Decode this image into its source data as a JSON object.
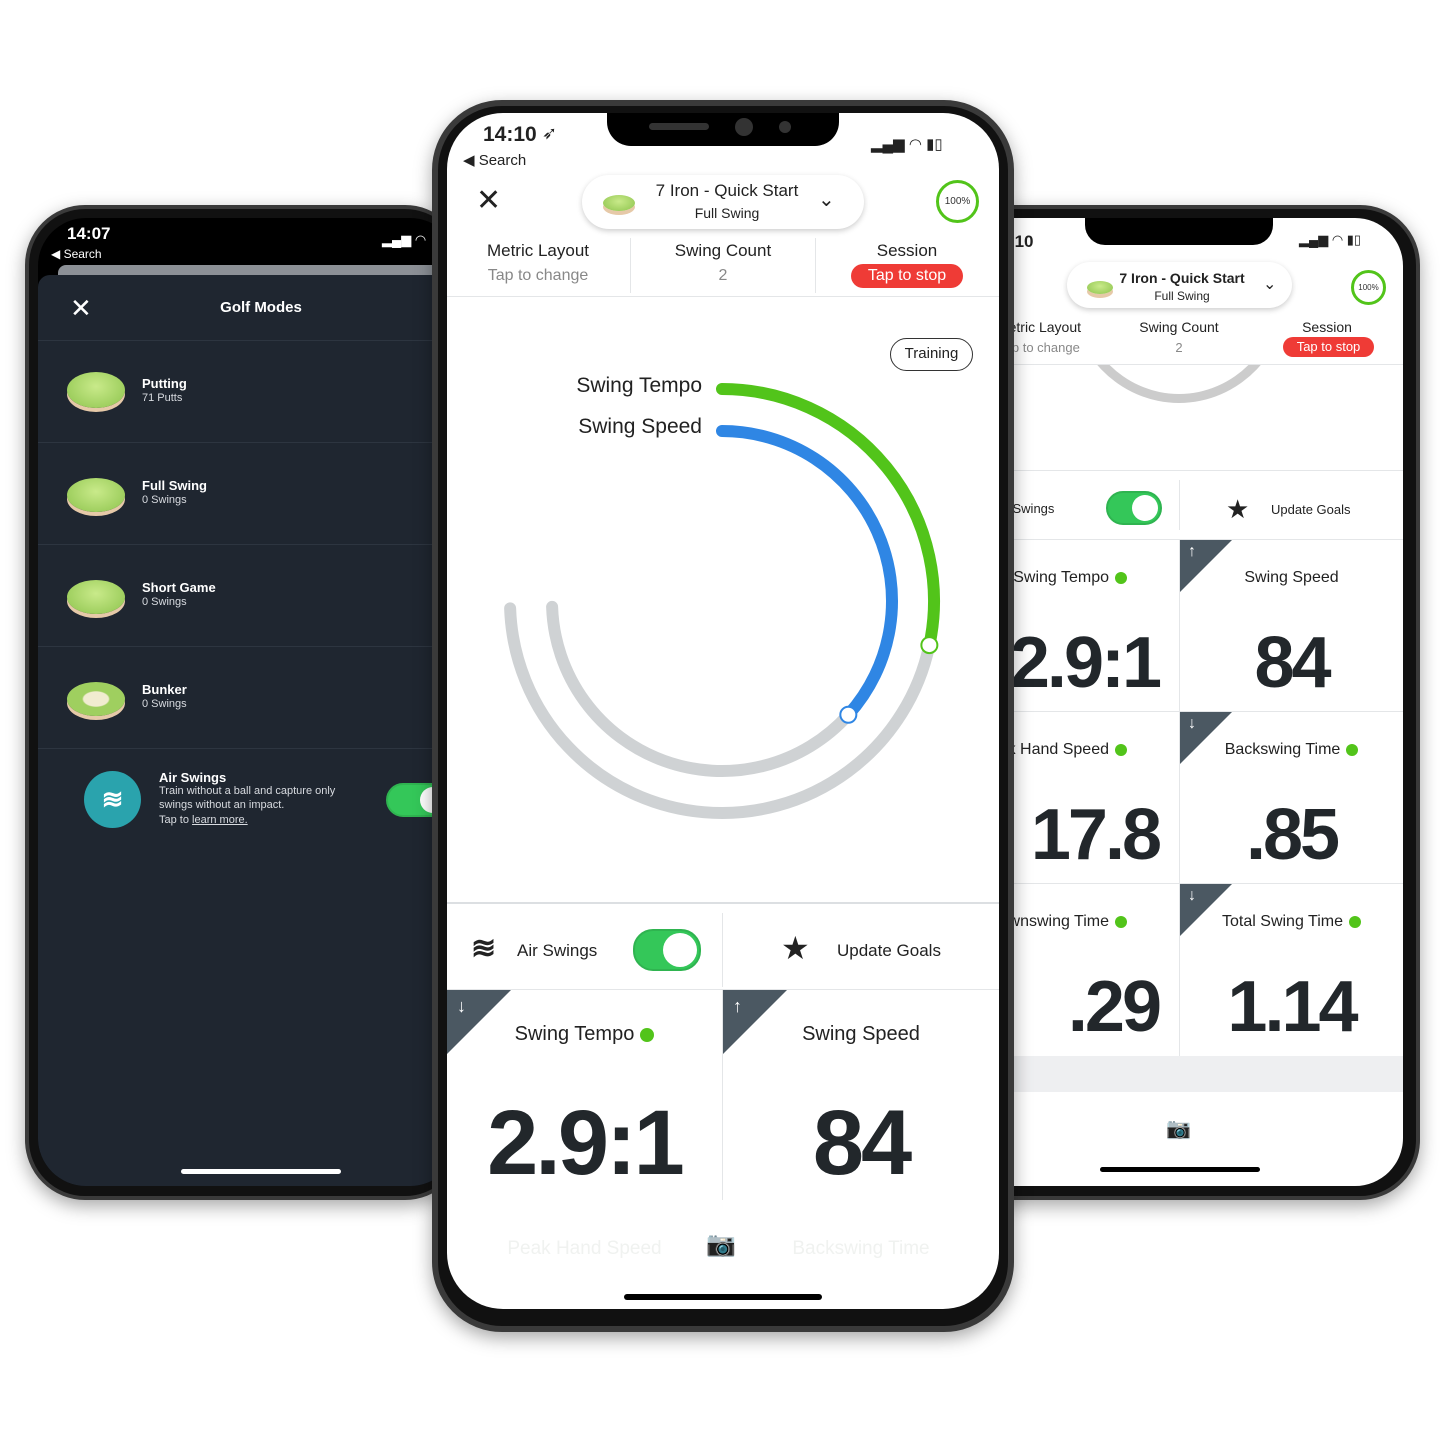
{
  "left_phone": {
    "status": {
      "time": "14:07",
      "back": "◀ Search"
    },
    "title": "Golf Modes",
    "modes": [
      {
        "name": "Putting",
        "count": "71 Putts"
      },
      {
        "name": "Full Swing",
        "count": "0 Swings"
      },
      {
        "name": "Short Game",
        "count": "0 Swings"
      },
      {
        "name": "Bunker",
        "count": "0 Swings"
      }
    ],
    "air_swings": {
      "title": "Air Swings",
      "desc1": "Train without a ball and capture only",
      "desc2": "swings without an impact.",
      "tap": "Tap to ",
      "link": "learn more.",
      "enabled": true
    }
  },
  "center_phone": {
    "status": {
      "time": "14:10",
      "back": "◀ Search"
    },
    "club": {
      "title": "7 Iron - Quick Start",
      "mode": "Full Swing"
    },
    "battery": "100%",
    "stats": [
      {
        "label": "Metric Layout",
        "value": "Tap to change"
      },
      {
        "label": "Swing Count",
        "value": "2"
      },
      {
        "label": "Session",
        "value": "Tap to stop"
      }
    ],
    "training": "Training",
    "gauge": {
      "outer_label": "Swing Tempo",
      "inner_label": "Swing Speed",
      "colors": {
        "tempo": "#52c41a",
        "speed": "#2f86e4",
        "track": "#cfd2d4"
      }
    },
    "air_swings_label": "Air Swings",
    "air_swings_on": true,
    "update_goals": "Update Goals",
    "metrics": [
      {
        "label": "Swing Tempo",
        "value": "2.9:1",
        "trend": "down",
        "dot": true
      },
      {
        "label": "Swing Speed",
        "value": "84",
        "trend": "up",
        "dot": false
      }
    ],
    "faded_metrics": [
      "Peak Hand Speed",
      "Backswing Time"
    ]
  },
  "right_phone": {
    "status": {
      "time": "14:10"
    },
    "club": {
      "title": "7 Iron - Quick Start",
      "mode": "Full Swing"
    },
    "battery": "100%",
    "stats": [
      {
        "label": "Metric Layout",
        "value": "Tap to change"
      },
      {
        "label": "Swing Count",
        "value": "2"
      },
      {
        "label": "Session",
        "value": "Tap to stop"
      }
    ],
    "air_swings_label": "Air Swings",
    "update_goals": "Update Goals",
    "metrics": [
      {
        "label": "Swing Tempo",
        "value": "2.9:1"
      },
      {
        "label": "Swing Speed",
        "value": "84"
      },
      {
        "label": "Peak Hand Speed",
        "value": "17.8"
      },
      {
        "label": "Backswing Time",
        "value": ".85"
      },
      {
        "label": "Downswing Time",
        "value": ".29"
      },
      {
        "label": "Total Swing Time",
        "value": "1.14"
      }
    ]
  }
}
